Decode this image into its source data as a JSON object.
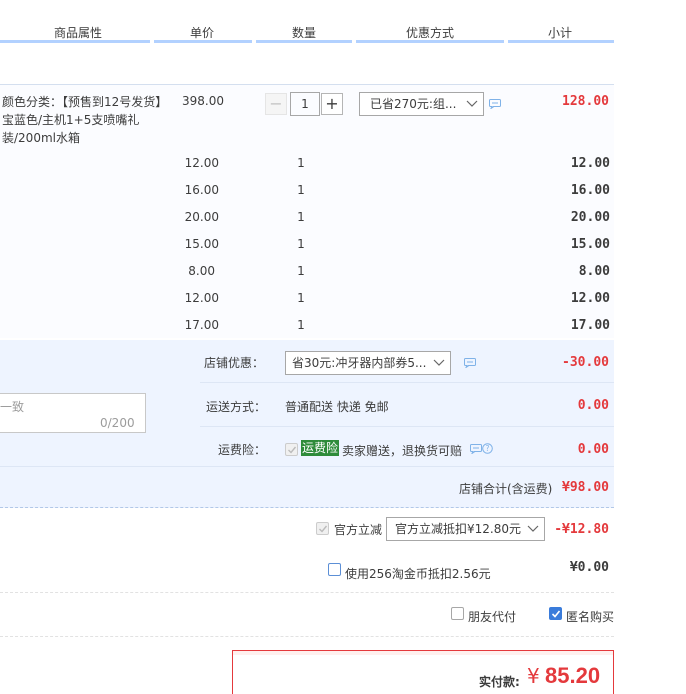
{
  "header": {
    "col_attr": "商品属性",
    "col_price": "单价",
    "col_qty": "数量",
    "col_promo": "优惠方式",
    "col_subtotal": "小计"
  },
  "item": {
    "attr_text": "颜色分类：【预售到12号发货】宝蓝色/主机1+5支喷嘴礼装/200ml水箱",
    "price": "398.00",
    "quantity": "1",
    "promo_select": "已省270元:组...",
    "subtotal": "128.00",
    "minus_label": "−",
    "plus_label": "+"
  },
  "bundle_rows": [
    {
      "price": "12.00",
      "qty": "1",
      "subtotal": "12.00"
    },
    {
      "price": "16.00",
      "qty": "1",
      "subtotal": "16.00"
    },
    {
      "price": "20.00",
      "qty": "1",
      "subtotal": "20.00"
    },
    {
      "price": "15.00",
      "qty": "1",
      "subtotal": "15.00"
    },
    {
      "price": "8.00",
      "qty": "1",
      "subtotal": "8.00"
    },
    {
      "price": "12.00",
      "qty": "1",
      "subtotal": "12.00"
    },
    {
      "price": "17.00",
      "qty": "1",
      "subtotal": "17.00"
    }
  ],
  "shop": {
    "discount_label": "店铺优惠：",
    "discount_select": "省30元:冲牙器内部券5...",
    "discount_amount": "-30.00",
    "shipping_label": "运送方式：",
    "shipping_value": "普通配送 快递 免邮",
    "shipping_amount": "0.00",
    "insurance_label": "运费险：",
    "insurance_tag": "运费险",
    "insurance_text": "卖家赠送，退换货可赔",
    "insurance_amount": "0.00",
    "message_placeholder": "一致",
    "message_count": "0/200",
    "total_label": "店铺合计(含运费)",
    "total_amount": "¥98.00"
  },
  "official": {
    "label": "官方立减",
    "select": "官方立减抵扣¥12.80元",
    "amount": "-¥12.80"
  },
  "coins": {
    "label": "使用256淘金币抵扣2.56元",
    "amount": "¥0.00"
  },
  "options": {
    "friend_pay": "朋友代付",
    "anonymous": "匿名购买"
  },
  "final": {
    "label": "实付款:",
    "currency": "¥",
    "amount": "85.20"
  },
  "colors": {
    "accent_red": "#e4393c",
    "header_line": "#b2d1ff",
    "shop_bg": "#eef4ff",
    "checkbox_blue": "#3a7cdb",
    "insurance_green": "#2e8b3a"
  }
}
